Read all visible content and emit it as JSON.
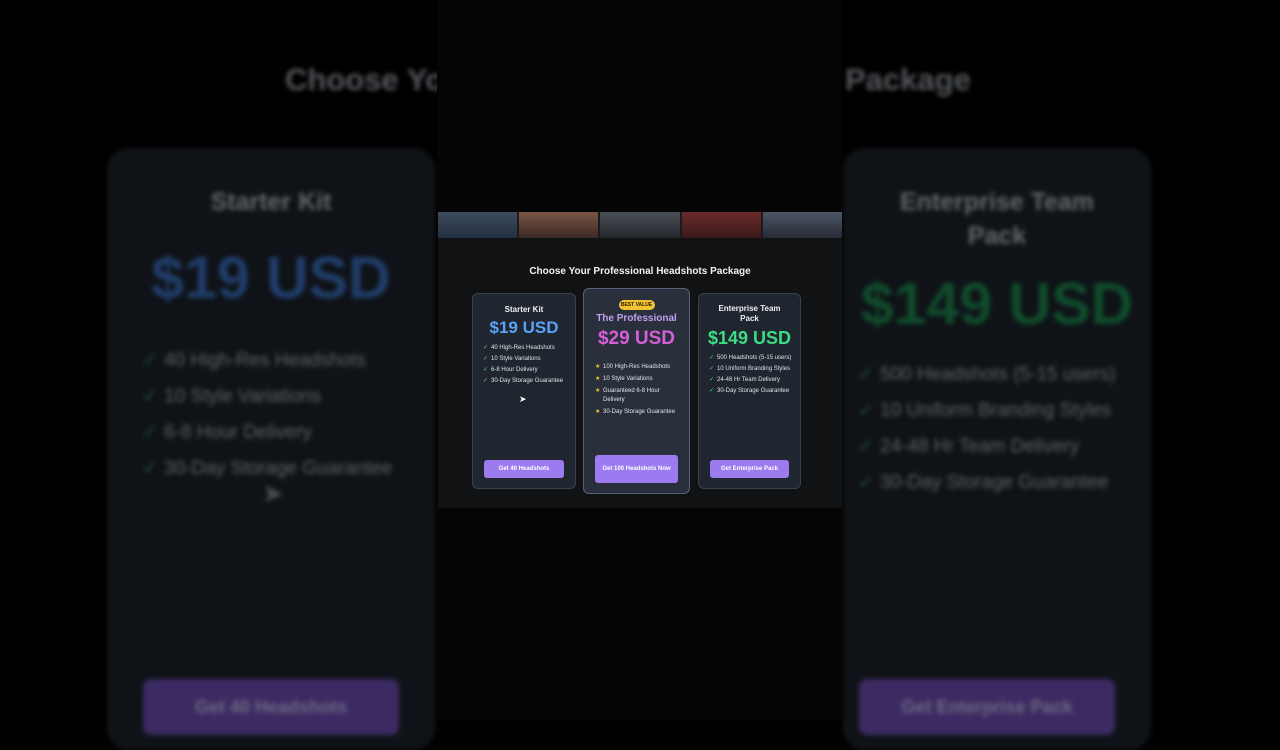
{
  "background": {
    "title_left": "Choose Yo",
    "title_right": "Package",
    "left_card": {
      "name": "Starter Kit",
      "price": "$19 USD",
      "features": [
        "40 High-Res Headshots",
        "10 Style Variations",
        "6-8 Hour Delivery",
        "30-Day Storage Guarantee"
      ],
      "button": "Get 40 Headshots"
    },
    "right_card": {
      "name": "Enterprise Team Pack",
      "price": "$149 USD",
      "features": [
        "500 Headshots (5-15 users)",
        "10 Uniform Branding Styles",
        "24-48 Hr Team Delivery",
        "30-Day Storage Guarantee"
      ],
      "button": "Get Enterprise Pack"
    }
  },
  "page": {
    "heading": "Choose Your Professional Headshots Package"
  },
  "plans": [
    {
      "name": "Starter Kit",
      "price": "$19 USD",
      "price_color": "#5aa2f5",
      "features": [
        "40 High-Res Headshots",
        "10 Style Variations",
        "6-8 Hour Delivery",
        "30-Day Storage Guarantee"
      ],
      "check_icon": "check-icon",
      "button": "Get 40 Headshots"
    },
    {
      "badge": "BEST VALUE",
      "name": "The Professional",
      "price": "$29 USD",
      "price_color": "#d45fd9",
      "features": [
        "100 High-Res Headshots",
        "10 Style Variations",
        "Guaranteed 6-8 Hour Delivery",
        "30-Day Storage Guarantee"
      ],
      "check_icon": "star-icon",
      "button": "Get 100 Headshots Now"
    },
    {
      "name": "Enterprise Team Pack",
      "price": "$149 USD",
      "price_color": "#3ddc84",
      "features": [
        "500 Headshots (5-15 users)",
        "10 Uniform Branding Styles",
        "24-48 Hr Team Delivery",
        "30-Day Storage Guarantee"
      ],
      "check_icon": "check-icon",
      "button": "Get Enterprise Pack"
    }
  ],
  "glyphs": {
    "check": "✓",
    "star": "★",
    "cursor": "➤"
  },
  "colors": {
    "accent_button": "#9b7bef",
    "badge": "#f1c232"
  }
}
